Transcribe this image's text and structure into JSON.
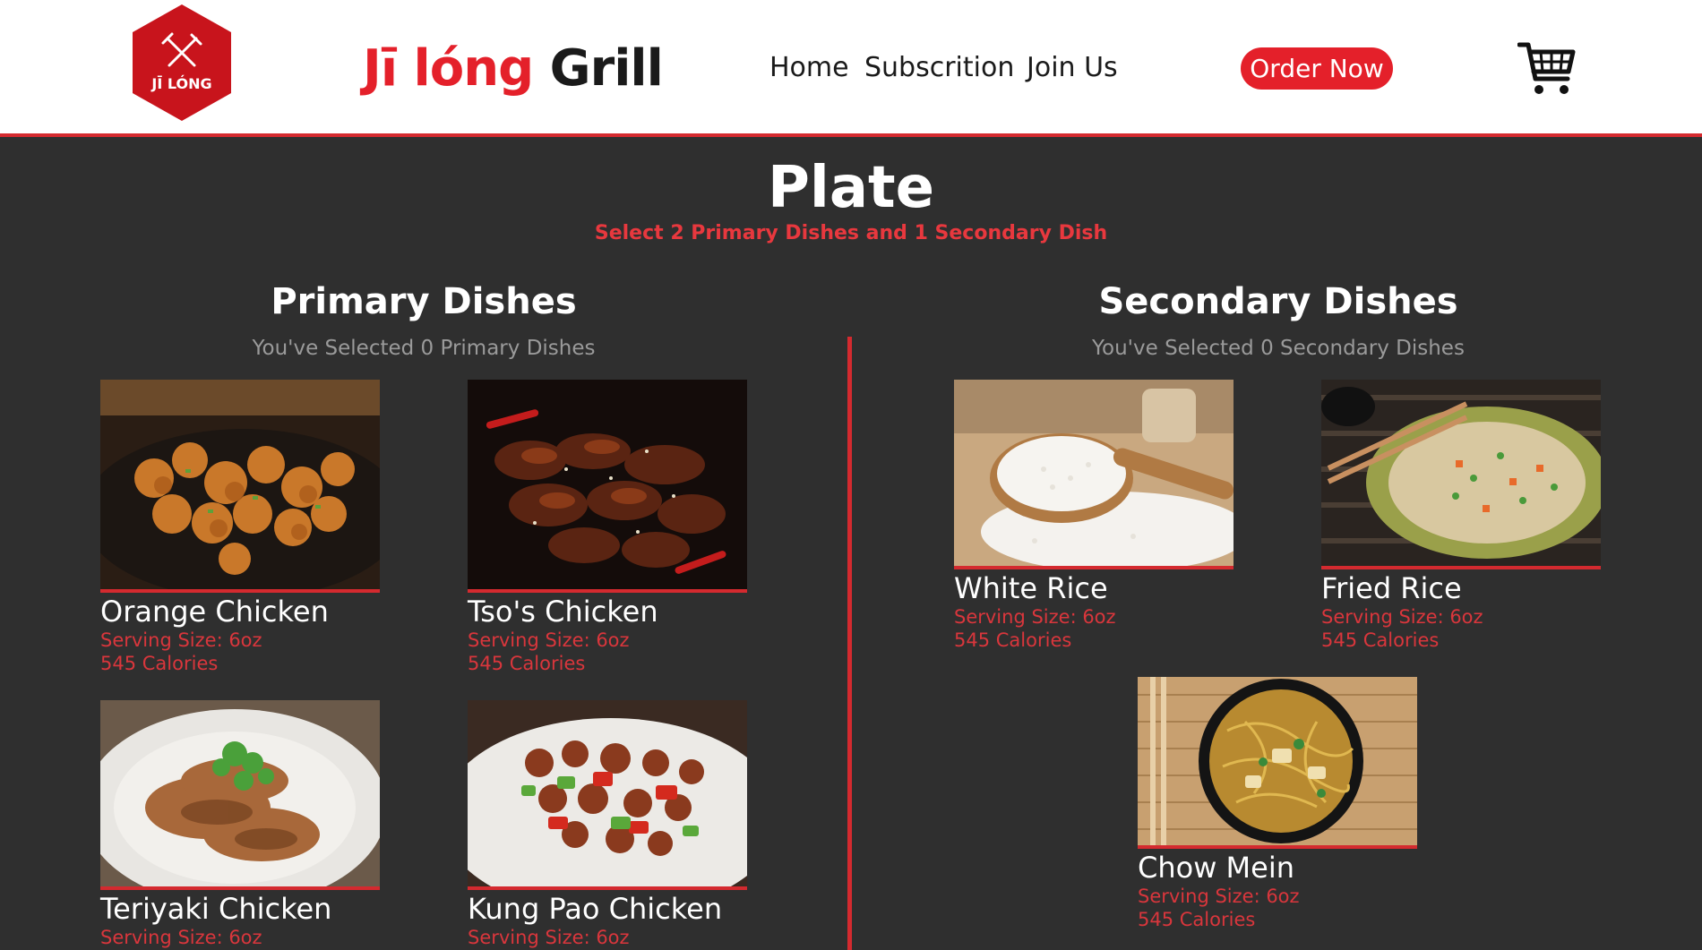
{
  "header": {
    "logo_text": "JĪ LÓNG",
    "brand_red": "Jī lóng",
    "brand_dark": "Grill",
    "nav": [
      "Home",
      "Subscrition",
      "Join Us"
    ],
    "order_button": "Order Now",
    "cart_icon": "shopping-cart-icon"
  },
  "page": {
    "title": "Plate",
    "subtitle": "Select 2 Primary Dishes and 1 Secondary Dish"
  },
  "primary": {
    "title": "Primary Dishes",
    "count_text": "You've Selected 0 Primary Dishes",
    "dishes": [
      {
        "name": "Orange Chicken",
        "serving": "Serving Size: 6oz",
        "calories": "545 Calories"
      },
      {
        "name": "Tso's Chicken",
        "serving": "Serving Size: 6oz",
        "calories": "545 Calories"
      },
      {
        "name": "Teriyaki Chicken",
        "serving": "Serving Size: 6oz",
        "calories": ""
      },
      {
        "name": "Kung Pao Chicken",
        "serving": "Serving Size: 6oz",
        "calories": ""
      }
    ]
  },
  "secondary": {
    "title": "Secondary Dishes",
    "count_text": "You've Selected 0 Secondary Dishes",
    "dishes": [
      {
        "name": "White Rice",
        "serving": "Serving Size: 6oz",
        "calories": "545 Calories"
      },
      {
        "name": "Fried Rice",
        "serving": "Serving Size: 6oz",
        "calories": "545 Calories"
      },
      {
        "name": "Chow Mein",
        "serving": "Serving Size: 6oz",
        "calories": "545 Calories"
      }
    ]
  },
  "colors": {
    "accent": "#e4202a",
    "background": "#2f2f2f",
    "header_bg": "#ffffff"
  }
}
